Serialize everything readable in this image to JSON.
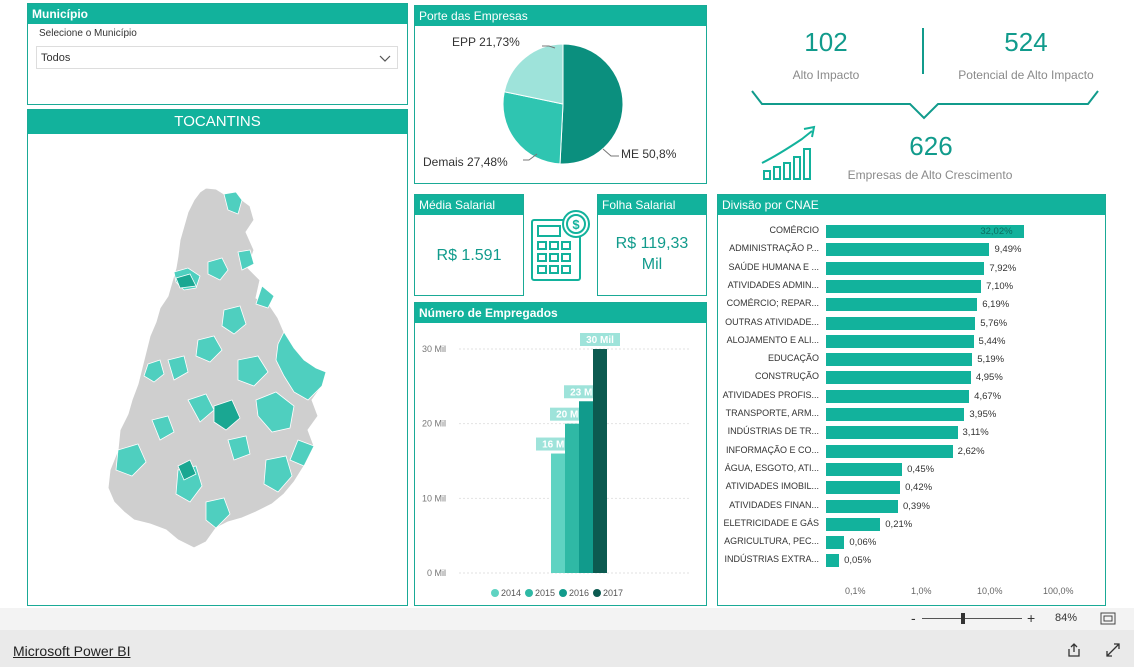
{
  "municipio": {
    "title": "Município",
    "select_label": "Selecione o Município",
    "select_value": "Todos"
  },
  "map": {
    "title": "TOCANTINS"
  },
  "porte": {
    "title": "Porte das Empresas",
    "slices": [
      {
        "label": "ME 50,8%",
        "value": 50.8,
        "color": "#0b8f7e"
      },
      {
        "label": "Demais 27,48%",
        "value": 27.48,
        "color": "#2fc5b1"
      },
      {
        "label": "EPP 21,73%",
        "value": 21.73,
        "color": "#9ee3da"
      }
    ]
  },
  "kpis": {
    "alto_impacto_value": "102",
    "alto_impacto_label": "Alto Impacto",
    "potencial_value": "524",
    "potencial_label": "Potencial de Alto Impacto",
    "crescimento_value": "626",
    "crescimento_label": "Empresas de Alto Crescimento"
  },
  "media_salarial": {
    "title": "Média Salarial",
    "value": "R$ 1.591"
  },
  "folha_salarial": {
    "title": "Folha Salarial",
    "value_line1": "R$ 119,33",
    "value_line2": "Mil"
  },
  "empregados": {
    "title": "Número de Empregados",
    "legend": [
      "2014",
      "2015",
      "2016",
      "2017"
    ]
  },
  "cnae": {
    "title": "Divisão por CNAE",
    "axis_ticks": [
      "0,1%",
      "1,0%",
      "10,0%",
      "100,0%"
    ]
  },
  "colors": {
    "teal": "#12b29c",
    "teal_dark": "#119b8c",
    "series": [
      "#5fd3c2",
      "#2fb9a5",
      "#119b8c",
      "#0c5a50"
    ]
  },
  "chart_data": [
    {
      "type": "pie",
      "title": "Porte das Empresas",
      "categories": [
        "ME",
        "Demais",
        "EPP"
      ],
      "values": [
        50.8,
        27.48,
        21.73
      ]
    },
    {
      "type": "bar",
      "title": "Número de Empregados",
      "categories": [
        "2014",
        "2015",
        "2016",
        "2017"
      ],
      "values": [
        16,
        20,
        23,
        30
      ],
      "value_labels": [
        "16 Mil",
        "20 Mil",
        "23 Mil",
        "30 Mil"
      ],
      "ylim": [
        0,
        30
      ],
      "y_ticks": [
        "0 Mil",
        "10 Mil",
        "20 Mil",
        "30 Mil"
      ]
    },
    {
      "type": "bar",
      "title": "Divisão por CNAE",
      "orientation": "horizontal",
      "scale": "log",
      "categories": [
        "COMÉRCIO",
        "ADMINISTRAÇÃO P...",
        "SAÚDE HUMANA E ...",
        "ATIVIDADES ADMIN...",
        "COMÉRCIO; REPAR...",
        "OUTRAS ATIVIDADE...",
        "ALOJAMENTO E ALI...",
        "EDUCAÇÃO",
        "CONSTRUÇÃO",
        "ATIVIDADES PROFIS...",
        "TRANSPORTE, ARM...",
        "INDÚSTRIAS DE TR...",
        "INFORMAÇÃO E CO...",
        "ÁGUA, ESGOTO, ATI...",
        "ATIVIDADES IMOBIL...",
        "ATIVIDADES FINAN...",
        "ELETRICIDADE E GÁS",
        "AGRICULTURA, PEC...",
        "INDÚSTRIAS EXTRA..."
      ],
      "values": [
        32.02,
        9.49,
        7.92,
        7.1,
        6.19,
        5.76,
        5.44,
        5.19,
        4.95,
        4.67,
        3.95,
        3.11,
        2.62,
        0.45,
        0.42,
        0.39,
        0.21,
        0.06,
        0.05
      ],
      "value_labels": [
        "32,02%",
        "9,49%",
        "7,92%",
        "7,10%",
        "6,19%",
        "5,76%",
        "5,44%",
        "5,19%",
        "4,95%",
        "4,67%",
        "3,95%",
        "3,11%",
        "2,62%",
        "0,45%",
        "0,42%",
        "0,39%",
        "0,21%",
        "0,06%",
        "0,05%"
      ],
      "x_ticks": [
        "0,1%",
        "1,0%",
        "10,0%",
        "100,0%"
      ]
    }
  ],
  "footer": {
    "brand": "Microsoft Power BI",
    "zoom": "84%",
    "minus": "-",
    "plus": "+"
  }
}
